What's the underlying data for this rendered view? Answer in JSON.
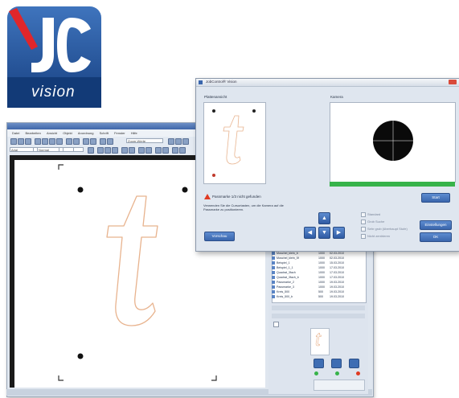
{
  "logo": {
    "letters": "JC",
    "wordmark": "vision",
    "colors": {
      "blue": "#1d4d94",
      "red": "#e0262b"
    }
  },
  "editor": {
    "menu": [
      "Datei",
      "Bearbeiten",
      "Ansicht",
      "Objekt",
      "Anordnung",
      "Schrift",
      "Fenster",
      "Hilfe"
    ],
    "zoom_value": "Zoom-Werte",
    "font_value": "Arial",
    "style_value": "Normal"
  },
  "panel": {
    "rows": [
      {
        "name": "Muschel_klein_b",
        "qty": "1000",
        "date": "02.03.2010"
      },
      {
        "name": "Muschel_klein_5f",
        "qty": "1000",
        "date": "02.03.2010"
      },
      {
        "name": "Beispiel_1",
        "qty": "1000",
        "date": "15.03.2010"
      },
      {
        "name": "Beispiel_1_1",
        "qty": "1000",
        "date": "17.03.2010"
      },
      {
        "name": "Quadrat_3fach",
        "qty": "1000",
        "date": "17.03.2010"
      },
      {
        "name": "Quadrat_3fach_b",
        "qty": "1000",
        "date": "17.03.2010"
      },
      {
        "name": "Passmarke_2",
        "qty": "1000",
        "date": "19.03.2010"
      },
      {
        "name": "Passmarke_3",
        "qty": "1000",
        "date": "19.03.2010"
      },
      {
        "name": "Kreis_500",
        "qty": "500",
        "date": "19.03.2010"
      },
      {
        "name": "Kreis_500_b",
        "qty": "500",
        "date": "19.03.2010"
      }
    ],
    "thumbnail_letter": "t"
  },
  "dialog": {
    "title": "JobControl® Vision",
    "preview_label": "Plattenansicht",
    "camera_label": "Kamera",
    "warning": "Passmarke 1/3 nicht gefunden",
    "instructions": "Verwenden Sie die Cursortasten, um die Kamera auf die Passmarke zu positionieren.",
    "buttons": {
      "preview": "Vorschau",
      "start": "Start",
      "settings": "Einstellungen",
      "ok": "OK"
    },
    "checkboxes": [
      "Standard",
      "Grob Suche",
      "Sehr grob (überhaupt Stufe)",
      "Nicht zentrieren"
    ],
    "colors": {
      "progress": "#37b34a",
      "panel": "#dfe6ef",
      "accent": "#3a66ad",
      "warning": "#e03a22"
    }
  },
  "artwork": {
    "glyph": "t",
    "glyph_color": "#e8b38e"
  }
}
